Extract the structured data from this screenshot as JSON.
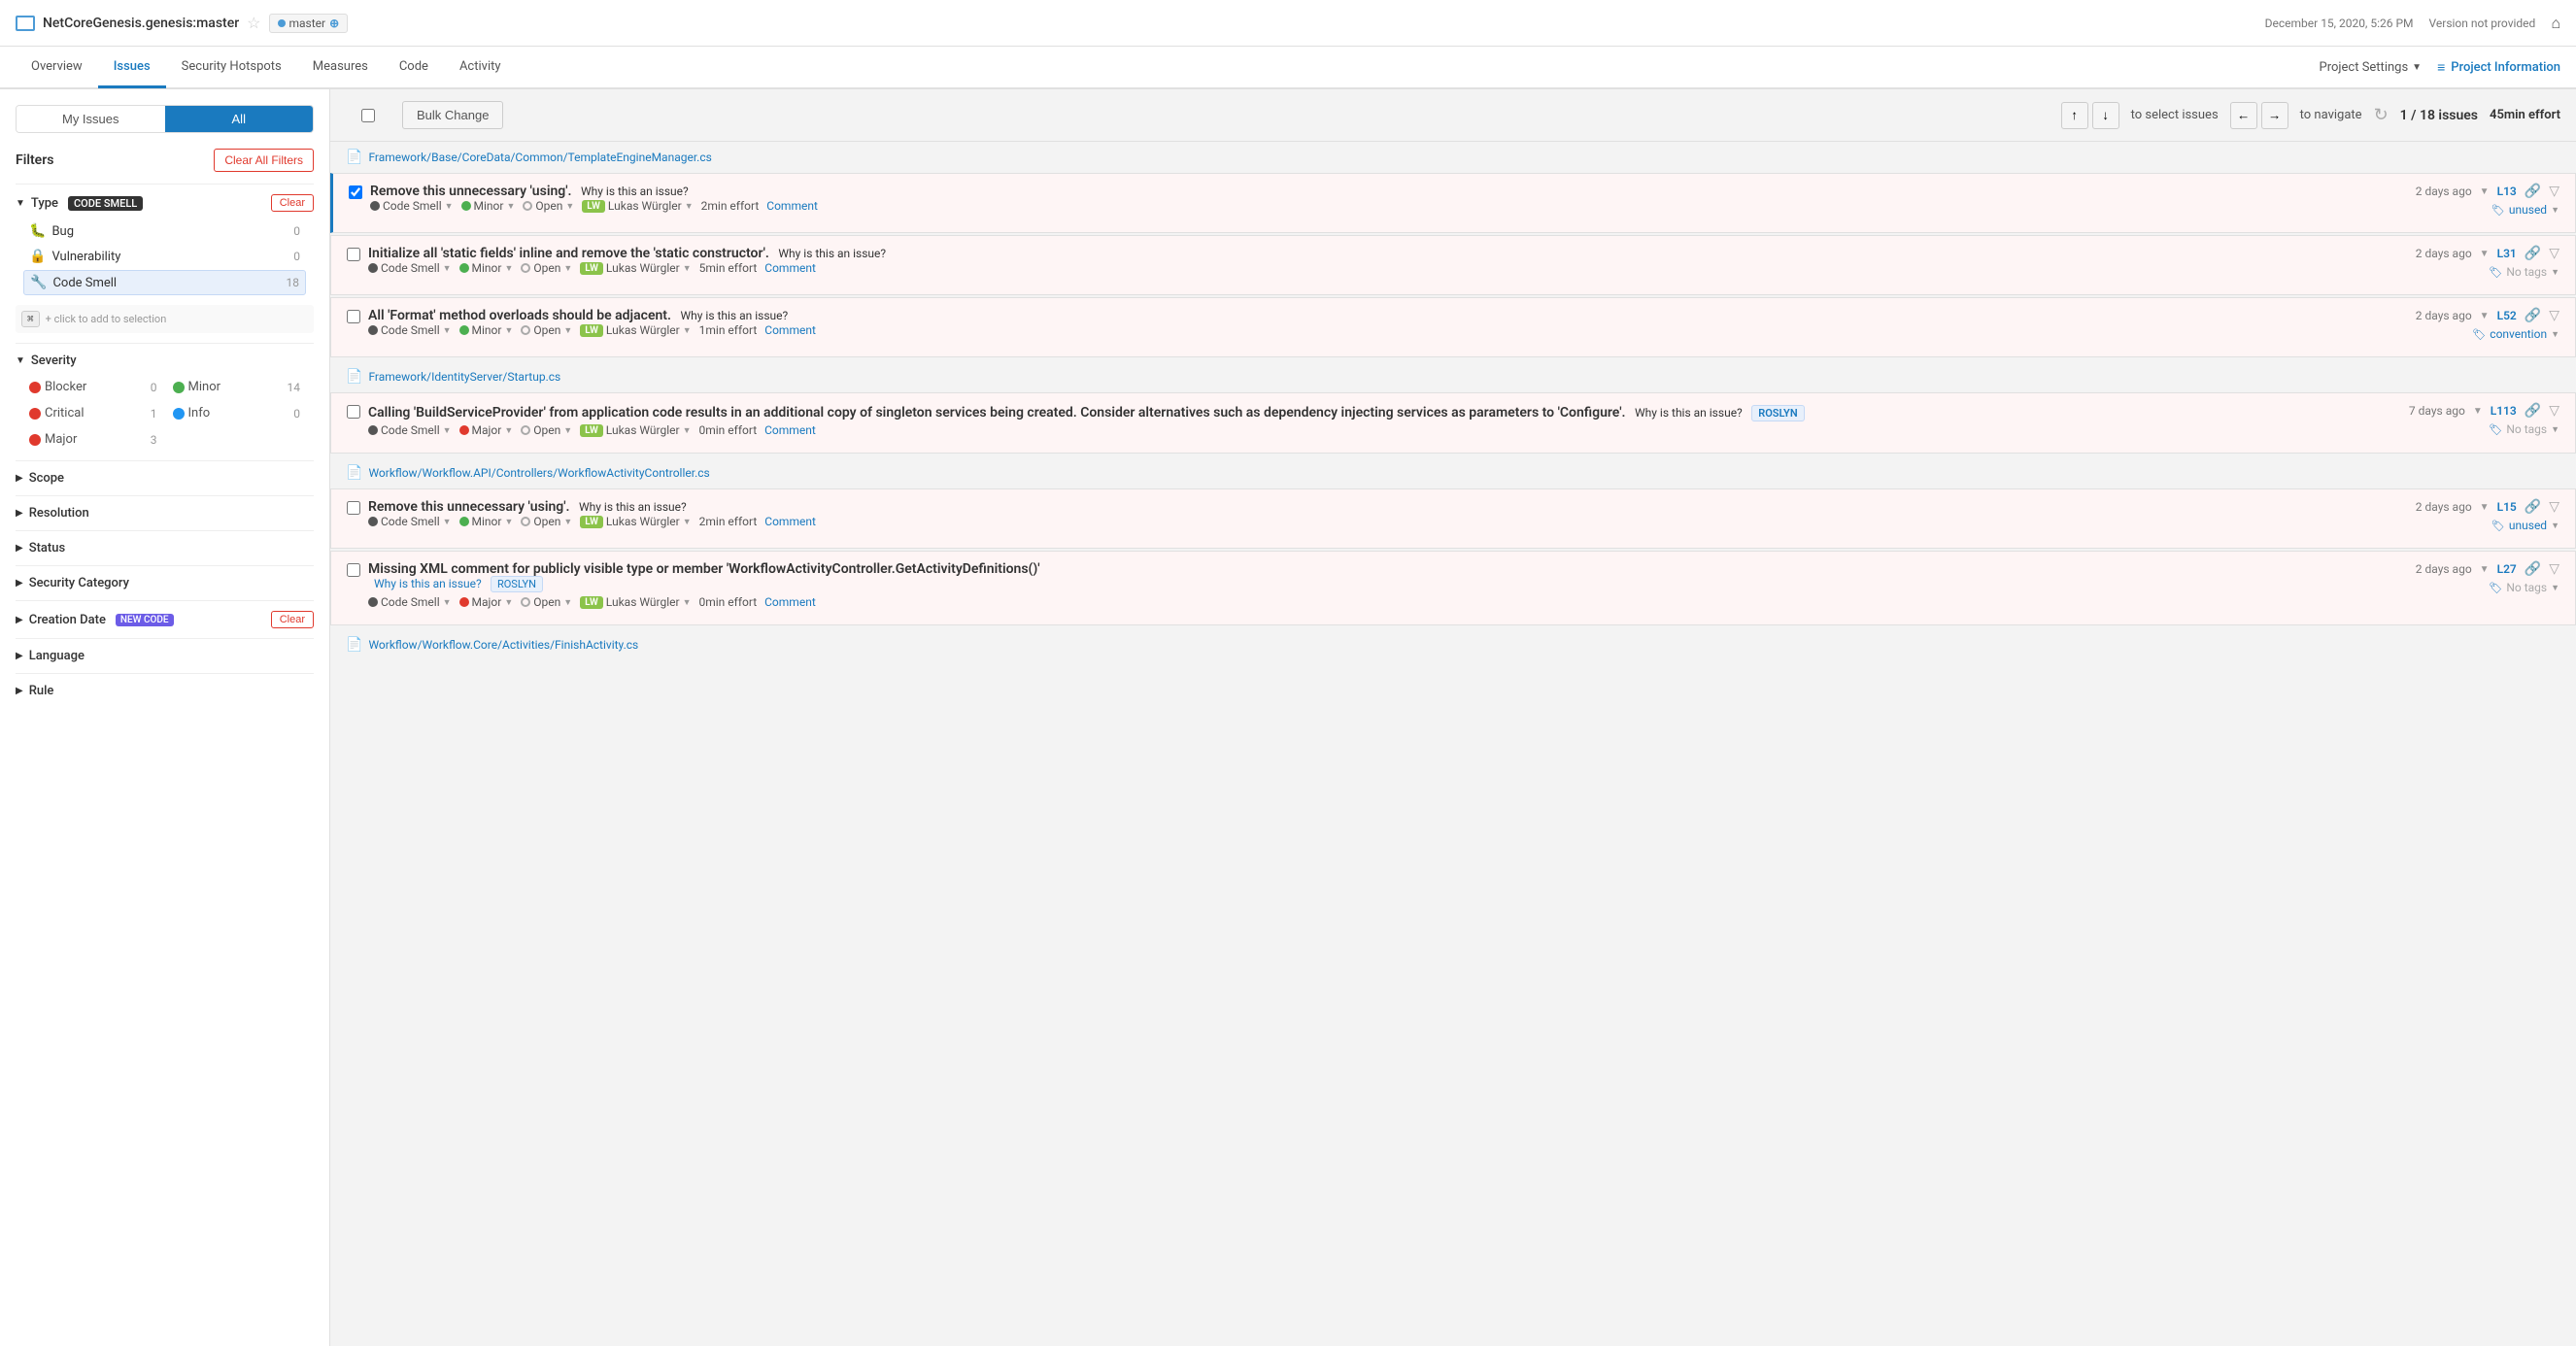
{
  "topbar": {
    "project_title": "NetCoreGenesis.genesis:master",
    "branch": "master",
    "datetime": "December 15, 2020, 5:26 PM",
    "version": "Version not provided"
  },
  "nav": {
    "items": [
      {
        "label": "Overview",
        "active": false
      },
      {
        "label": "Issues",
        "active": true
      },
      {
        "label": "Security Hotspots",
        "active": false
      },
      {
        "label": "Measures",
        "active": false
      },
      {
        "label": "Code",
        "active": false
      },
      {
        "label": "Activity",
        "active": false
      }
    ],
    "project_settings": "Project Settings",
    "project_info": "Project Information"
  },
  "sidebar": {
    "my_issues": "My Issues",
    "all": "All",
    "filters_title": "Filters",
    "clear_all_filters": "Clear All Filters",
    "type_label": "Type",
    "type_value": "CODE SMELL",
    "clear_label": "Clear",
    "filter_items": [
      {
        "label": "Bug",
        "count": "0",
        "type": "bug"
      },
      {
        "label": "Vulnerability",
        "count": "0",
        "type": "vuln"
      },
      {
        "label": "Code Smell",
        "count": "18",
        "type": "smell",
        "selected": true
      }
    ],
    "kbd_hint": "+ click to add to selection",
    "severity_label": "Severity",
    "severity_items": [
      {
        "label": "Blocker",
        "count": "0",
        "level": "blocker"
      },
      {
        "label": "Minor",
        "count": "14",
        "level": "minor"
      },
      {
        "label": "Critical",
        "count": "1",
        "level": "critical"
      },
      {
        "label": "Info",
        "count": "0",
        "level": "info"
      },
      {
        "label": "Major",
        "count": "3",
        "level": "major"
      }
    ],
    "scope_label": "Scope",
    "resolution_label": "Resolution",
    "status_label": "Status",
    "security_category_label": "Security Category",
    "creation_date_label": "Creation Date",
    "creation_date_badge": "NEW CODE",
    "language_label": "Language",
    "rule_label": "Rule"
  },
  "toolbar": {
    "bulk_change": "Bulk Change",
    "to_select": "to select issues",
    "to_navigate": "to navigate",
    "issues_count": "1 / 18 issues",
    "effort": "45min effort"
  },
  "issues": [
    {
      "file": "Framework/Base/CoreData/Common/TemplateEngineManager.cs",
      "items": [
        {
          "id": "issue-1",
          "title": "Remove this unnecessary 'using'.",
          "why_link": "Why is this an issue?",
          "selected": true,
          "time": "2 days ago",
          "line": "L13",
          "type_label": "Code Smell",
          "severity_label": "Minor",
          "severity_level": "minor",
          "status_label": "Open",
          "assignee": "LW",
          "assignee_name": "Lukas Würgler",
          "effort": "2min effort",
          "comment": "Comment",
          "tag": "unused",
          "has_tag": true,
          "roslyn": false,
          "multi_line": false
        },
        {
          "id": "issue-2",
          "title": "Initialize all 'static fields' inline and remove the 'static constructor'.",
          "why_link": "Why is this an issue?",
          "selected": false,
          "time": "2 days ago",
          "line": "L31",
          "type_label": "Code Smell",
          "severity_label": "Minor",
          "severity_level": "minor",
          "status_label": "Open",
          "assignee": "LW",
          "assignee_name": "Lukas Würgler",
          "effort": "5min effort",
          "comment": "Comment",
          "tag": "No tags",
          "has_tag": false,
          "roslyn": false,
          "multi_line": false
        },
        {
          "id": "issue-3",
          "title": "All 'Format' method overloads should be adjacent.",
          "why_link": "Why is this an issue?",
          "selected": false,
          "time": "2 days ago",
          "line": "L52",
          "type_label": "Code Smell",
          "severity_label": "Minor",
          "severity_level": "minor",
          "status_label": "Open",
          "assignee": "LW",
          "assignee_name": "Lukas Würgler",
          "effort": "1min effort",
          "comment": "Comment",
          "tag": "convention",
          "has_tag": true,
          "roslyn": false,
          "multi_line": false
        }
      ]
    },
    {
      "file": "Framework/IdentityServer/Startup.cs",
      "items": [
        {
          "id": "issue-4",
          "title": "Calling 'BuildServiceProvider' from application code results in an additional copy of singleton services being created. Consider alternatives such as dependency injecting services as parameters to 'Configure'.",
          "why_link": "Why is this an issue?",
          "selected": false,
          "time": "7 days ago",
          "line": "L113",
          "type_label": "Code Smell",
          "severity_label": "Major",
          "severity_level": "major",
          "status_label": "Open",
          "assignee": "LW",
          "assignee_name": "Lukas Würgler",
          "effort": "0min effort",
          "comment": "Comment",
          "tag": "No tags",
          "has_tag": false,
          "roslyn": true,
          "multi_line": true
        }
      ]
    },
    {
      "file": "Workflow/Workflow.API/Controllers/WorkflowActivityController.cs",
      "items": [
        {
          "id": "issue-5",
          "title": "Remove this unnecessary 'using'.",
          "why_link": "Why is this an issue?",
          "selected": false,
          "time": "2 days ago",
          "line": "L15",
          "type_label": "Code Smell",
          "severity_label": "Minor",
          "severity_level": "minor",
          "status_label": "Open",
          "assignee": "LW",
          "assignee_name": "Lukas Würgler",
          "effort": "2min effort",
          "comment": "Comment",
          "tag": "unused",
          "has_tag": true,
          "roslyn": false,
          "multi_line": false
        },
        {
          "id": "issue-6",
          "title": "Missing XML comment for publicly visible type or member 'WorkflowActivityController.GetActivityDefinitions()'",
          "why_link": "Why is this an issue?",
          "selected": false,
          "time": "2 days ago",
          "line": "L27",
          "type_label": "Code Smell",
          "severity_label": "Major",
          "severity_level": "major",
          "status_label": "Open",
          "assignee": "LW",
          "assignee_name": "Lukas Würgler",
          "effort": "0min effort",
          "comment": "Comment",
          "tag": "No tags",
          "has_tag": false,
          "roslyn": true,
          "multi_line": false
        }
      ]
    },
    {
      "file": "Workflow/Workflow.Core/Activities/FinishActivity.cs",
      "items": []
    }
  ]
}
